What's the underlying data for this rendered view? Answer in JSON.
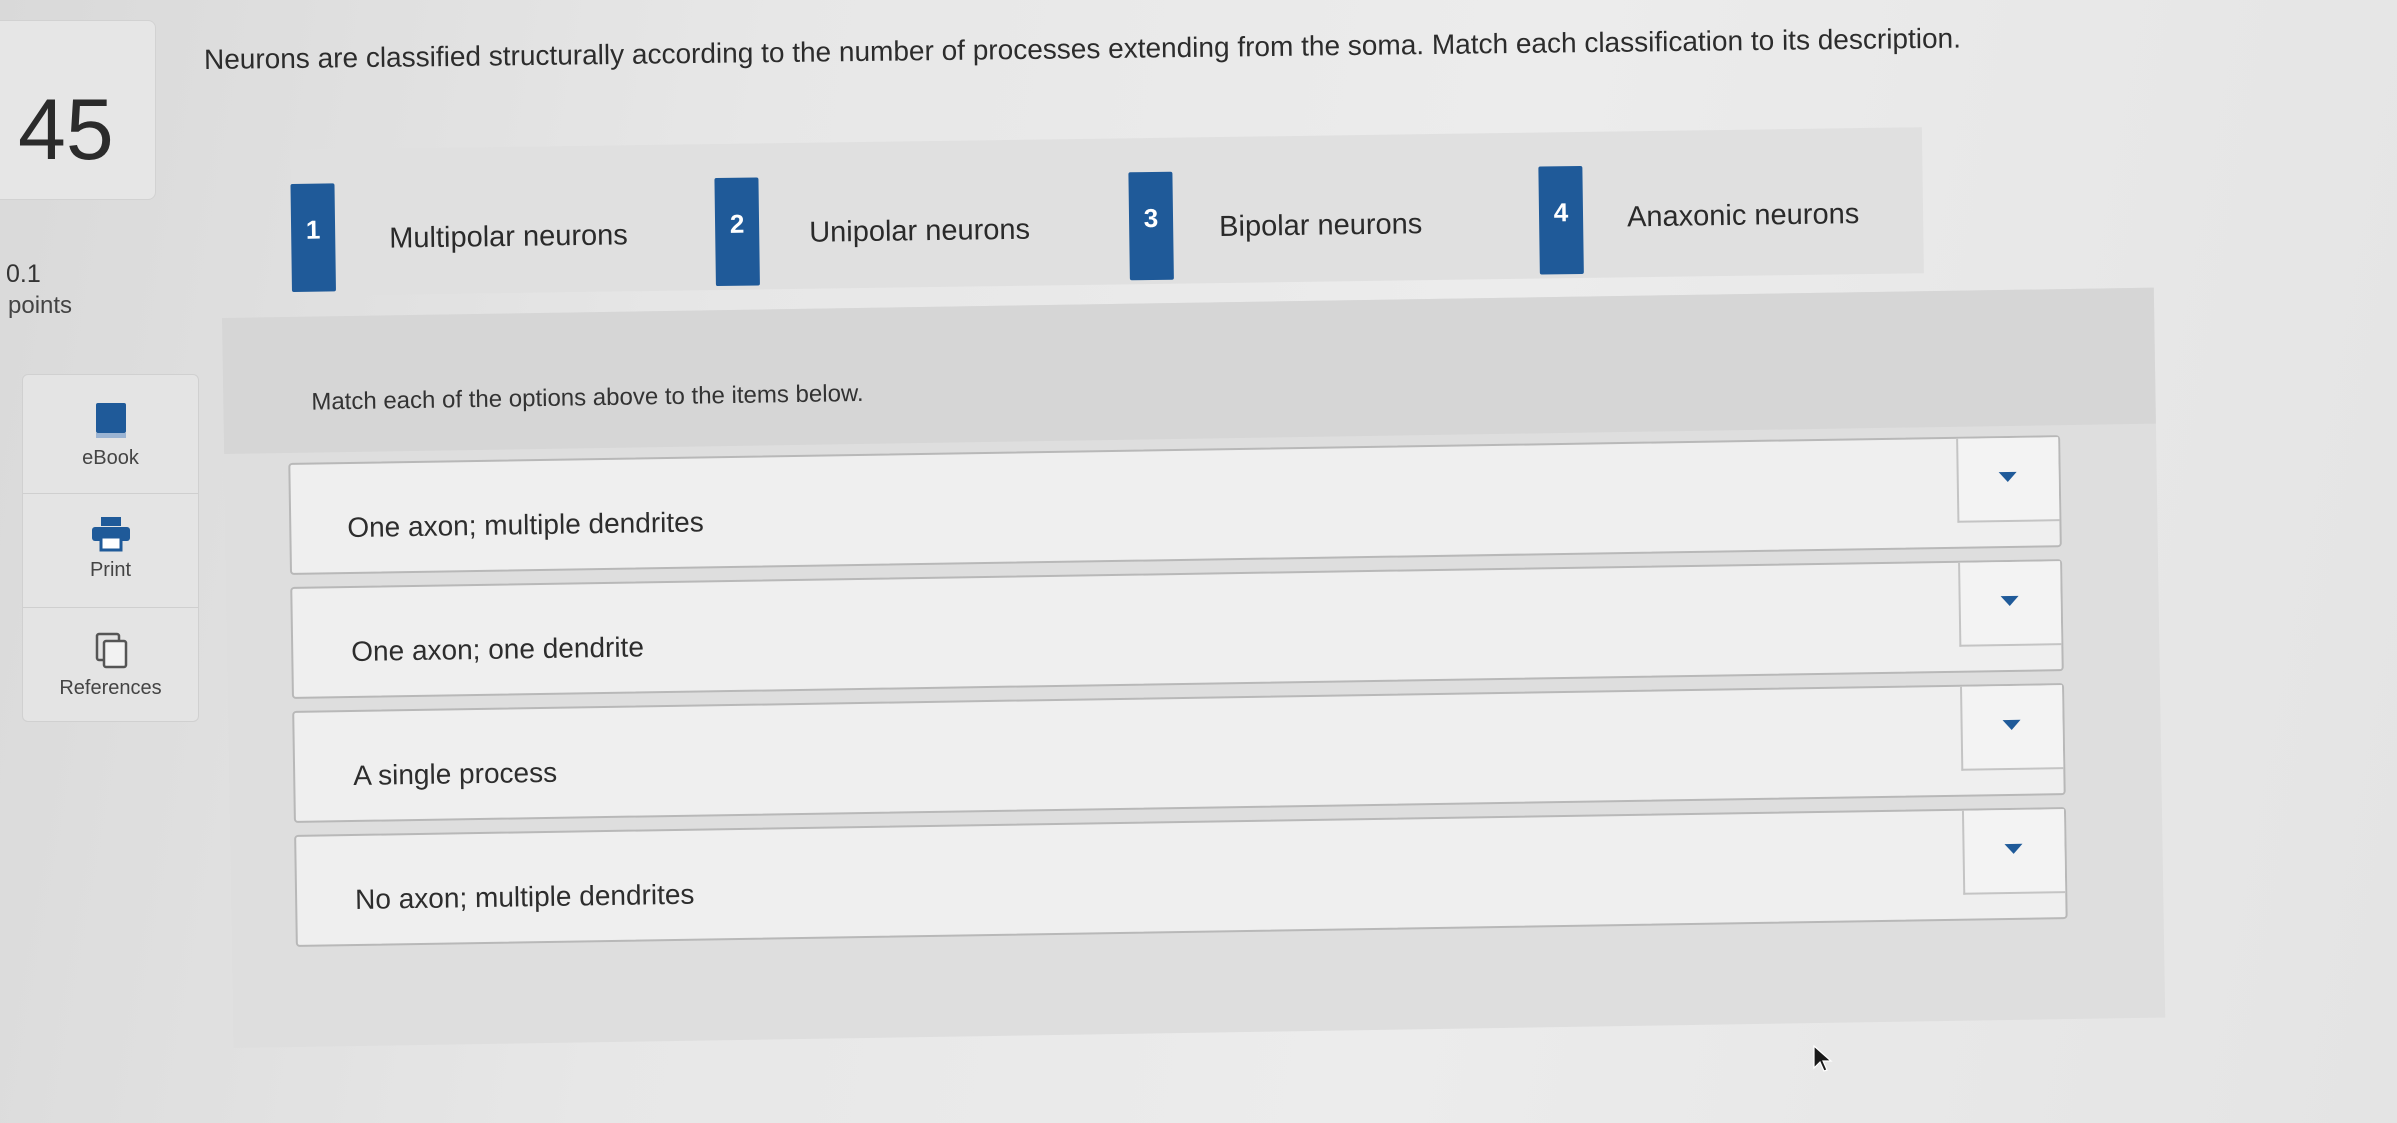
{
  "question": {
    "number": "45",
    "points_value": "0.1",
    "points_label": "points",
    "text": "Neurons are classified structurally according to the number of processes extending from the soma. Match each classification to its description."
  },
  "tools": [
    {
      "label": "eBook",
      "icon": "book-icon"
    },
    {
      "label": "Print",
      "icon": "printer-icon"
    },
    {
      "label": "References",
      "icon": "copy-documents-icon"
    }
  ],
  "options": [
    {
      "num": "1",
      "label": "Multipolar neurons"
    },
    {
      "num": "2",
      "label": "Unipolar neurons"
    },
    {
      "num": "3",
      "label": "Bipolar neurons"
    },
    {
      "num": "4",
      "label": "Anaxonic neurons"
    }
  ],
  "instruction": "Match each of the options above to the items below.",
  "items": [
    {
      "text": "One axon; multiple dendrites"
    },
    {
      "text": "One axon; one dendrite"
    },
    {
      "text": "A single process"
    },
    {
      "text": "No axon; multiple dendrites"
    }
  ],
  "colors": {
    "accent": "#1f5a99"
  }
}
